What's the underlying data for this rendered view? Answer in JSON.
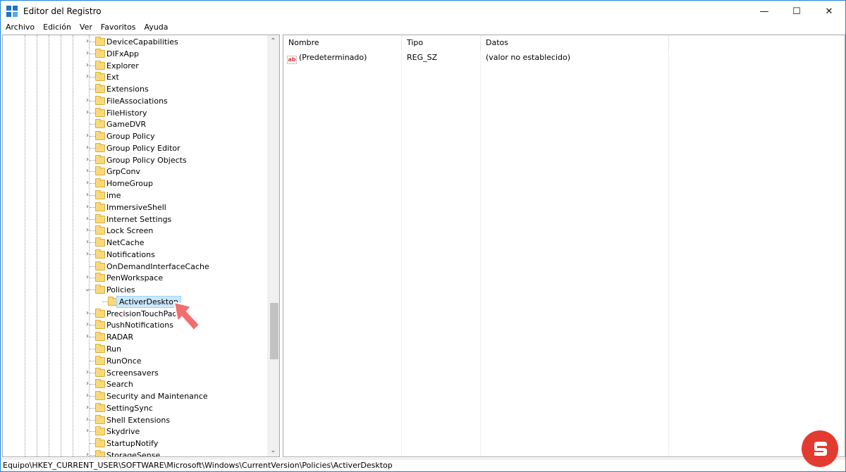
{
  "window": {
    "title": "Editor del Registro",
    "controls": {
      "minimize": "—",
      "maximize": "☐",
      "close": "✕"
    }
  },
  "menu": [
    "Archivo",
    "Edición",
    "Ver",
    "Favoritos",
    "Ayuda"
  ],
  "tree": {
    "items": [
      {
        "label": "DeviceCapabilities",
        "expander": "collapsed"
      },
      {
        "label": "DIFxApp",
        "expander": "collapsed"
      },
      {
        "label": "Explorer",
        "expander": "collapsed"
      },
      {
        "label": "Ext",
        "expander": "collapsed"
      },
      {
        "label": "Extensions",
        "expander": "none"
      },
      {
        "label": "FileAssociations",
        "expander": "collapsed"
      },
      {
        "label": "FileHistory",
        "expander": "collapsed"
      },
      {
        "label": "GameDVR",
        "expander": "none"
      },
      {
        "label": "Group Policy",
        "expander": "collapsed"
      },
      {
        "label": "Group Policy Editor",
        "expander": "collapsed"
      },
      {
        "label": "Group Policy Objects",
        "expander": "collapsed"
      },
      {
        "label": "GrpConv",
        "expander": "collapsed"
      },
      {
        "label": "HomeGroup",
        "expander": "collapsed"
      },
      {
        "label": "ime",
        "expander": "collapsed"
      },
      {
        "label": "ImmersiveShell",
        "expander": "collapsed"
      },
      {
        "label": "Internet Settings",
        "expander": "collapsed"
      },
      {
        "label": "Lock Screen",
        "expander": "collapsed"
      },
      {
        "label": "NetCache",
        "expander": "collapsed"
      },
      {
        "label": "Notifications",
        "expander": "collapsed"
      },
      {
        "label": "OnDemandInterfaceCache",
        "expander": "none"
      },
      {
        "label": "PenWorkspace",
        "expander": "collapsed"
      },
      {
        "label": "Policies",
        "expander": "expanded"
      },
      {
        "label": "ActiverDesktop",
        "expander": "none",
        "child": true,
        "selected": true
      },
      {
        "label": "PrecisionTouchPad",
        "expander": "collapsed"
      },
      {
        "label": "PushNotifications",
        "expander": "collapsed"
      },
      {
        "label": "RADAR",
        "expander": "collapsed"
      },
      {
        "label": "Run",
        "expander": "none"
      },
      {
        "label": "RunOnce",
        "expander": "none"
      },
      {
        "label": "Screensavers",
        "expander": "collapsed"
      },
      {
        "label": "Search",
        "expander": "collapsed"
      },
      {
        "label": "Security and Maintenance",
        "expander": "collapsed"
      },
      {
        "label": "SettingSync",
        "expander": "collapsed"
      },
      {
        "label": "Shell Extensions",
        "expander": "collapsed"
      },
      {
        "label": "Skydrive",
        "expander": "collapsed"
      },
      {
        "label": "StartupNotify",
        "expander": "none"
      },
      {
        "label": "StorageSense",
        "expander": "collapsed"
      }
    ]
  },
  "list": {
    "columns": [
      "Nombre",
      "Tipo",
      "Datos"
    ],
    "rows": [
      {
        "name": "(Predeterminado)",
        "type": "REG_SZ",
        "data": "(valor no establecido)",
        "icon": "ab"
      }
    ]
  },
  "status": {
    "path": "Equipo\\HKEY_CURRENT_USER\\SOFTWARE\\Microsoft\\Windows\\CurrentVersion\\Policies\\ActiverDesktop"
  },
  "icons": {
    "folder_fill": "#f9d97a",
    "selection_bg": "#cce8ff",
    "pointer_color": "#f26d6d",
    "arrow_up": "⌃",
    "arrow_down": "⌄",
    "expand": "›",
    "collapse": "⌄"
  }
}
